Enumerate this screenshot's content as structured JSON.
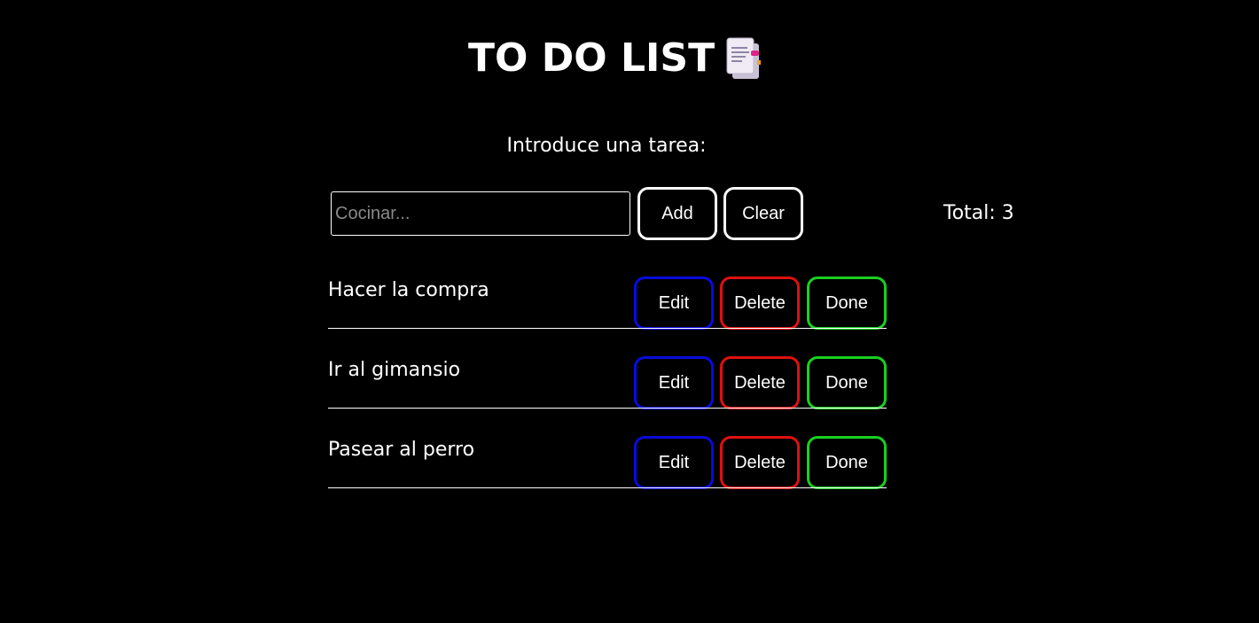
{
  "header": {
    "title": "TO DO LIST",
    "title_icon": "document-icon"
  },
  "form": {
    "prompt": "Introduce una tarea:",
    "input_value": "",
    "input_placeholder": "Cocinar...",
    "add_label": "Add",
    "clear_label": "Clear",
    "total_text": "Total: 3"
  },
  "tasks": [
    {
      "label": "Hacer la compra",
      "edit": "Edit",
      "delete": "Delete",
      "done": "Done"
    },
    {
      "label": "Ir al gimansio",
      "edit": "Edit",
      "delete": "Delete",
      "done": "Done"
    },
    {
      "label": "Pasear al perro",
      "edit": "Edit",
      "delete": "Delete",
      "done": "Done"
    }
  ],
  "colors": {
    "background": "#000000",
    "text": "#ffffff",
    "edit_border": "#0a0adc",
    "delete_border": "#e01010",
    "done_border": "#18d020"
  }
}
